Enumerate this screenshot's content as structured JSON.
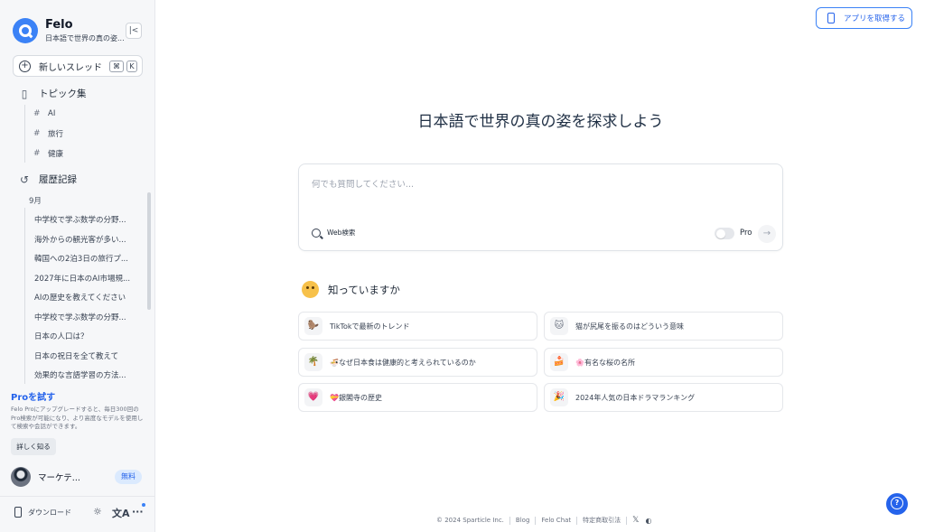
{
  "sidebar": {
    "brand_name": "Felo",
    "brand_sub": "日本語で世界の真の姿...",
    "collapse_icon": "collapse-left-icon",
    "new_thread": {
      "label": "新しいスレッド",
      "shortcut_1": "⌘",
      "shortcut_2": "K"
    },
    "topics_header": "トピック集",
    "topics": [
      {
        "label": "AI"
      },
      {
        "label": "旅行"
      },
      {
        "label": "健康"
      }
    ],
    "history_header": "履歴記録",
    "history_month": "9月",
    "history": [
      {
        "label": "中学校で学ぶ数学の分野..."
      },
      {
        "label": "海外からの観光客が多い..."
      },
      {
        "label": "韓国への2泊3日の旅行プ..."
      },
      {
        "label": "2027年に日本のAI市場規..."
      },
      {
        "label": "AIの歴史を教えてください"
      },
      {
        "label": "中学校で学ぶ数学の分野..."
      },
      {
        "label": "日本の人口は？"
      },
      {
        "label": "日本の祝日を全て教えて"
      },
      {
        "label": "効果的な言語学習の方法..."
      }
    ],
    "pro": {
      "title": "Proを試す",
      "description": "Felo Proにアップグレードすると、毎日300回のPro検索が可能になり、より高度なモデルを使用して検索や会話ができます。",
      "learn_more": "詳しく知る"
    },
    "user": {
      "name": "マーケテ...",
      "plan_badge": "無料"
    },
    "bottom": {
      "download": "ダウンロード"
    }
  },
  "header": {
    "get_app": "アプリを取得する"
  },
  "main": {
    "headline": "日本語で世界の真の姿を探求しよう",
    "search": {
      "placeholder": "何でも質問してください...",
      "web_search": "Web検索",
      "pro_label": "Pro",
      "send_icon": "→"
    },
    "know_header": "知っていますか",
    "suggestions": [
      {
        "emoji": "🦫",
        "label": "TikTokで最新のトレンド"
      },
      {
        "emoji": "🐱",
        "label": "猫が尻尾を振るのはどういう意味"
      },
      {
        "emoji": "🌴",
        "label": "🍜なぜ日本食は健康的と考えられているのか"
      },
      {
        "emoji": "🍰",
        "label": "🌸有名な桜の名所"
      },
      {
        "emoji": "💗",
        "label": "💝銀閣寺の歴史"
      },
      {
        "emoji": "🎉",
        "label": "2024年人気の日本ドラマランキング"
      }
    ]
  },
  "footer": {
    "copyright": "© 2024 Sparticle Inc.",
    "links": [
      "Blog",
      "Felo Chat",
      "特定商取引法"
    ]
  },
  "colors": {
    "accent": "#2563eb",
    "logo": "#3b82f6",
    "sidebar_bg": "#f6f7f9"
  }
}
